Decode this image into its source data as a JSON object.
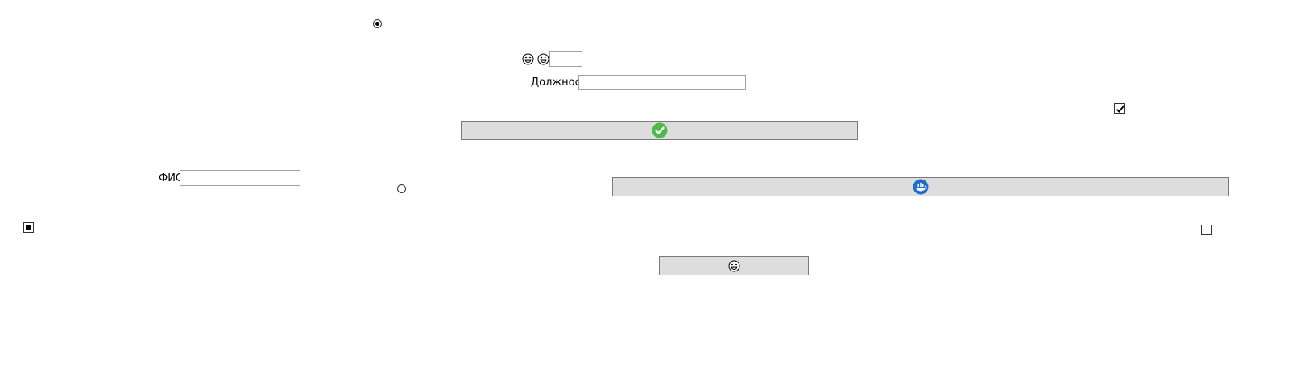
{
  "form": {
    "fio_label": "ФИО",
    "fio_value": "",
    "position_label": "Должность",
    "position_value": "",
    "small_field_value": ""
  },
  "radios": {
    "top_checked": true,
    "middle_checked": false
  },
  "checkboxes": {
    "right_top_checked": true,
    "left_state": "indeterminate",
    "right_bottom_checked": false
  },
  "icons": {
    "laughing_face": "laughing-face-icon",
    "grinning_face": "grinning-face-icon",
    "check_circle": "green-check-circle-icon",
    "blue_badge": "blue-round-badge-icon"
  },
  "colors": {
    "button_bg": "#dddddd",
    "button_border": "#7a7a7a",
    "field_border": "#a0a0a0",
    "check_green": "#4cbb4c",
    "badge_blue": "#1f6fc5"
  }
}
